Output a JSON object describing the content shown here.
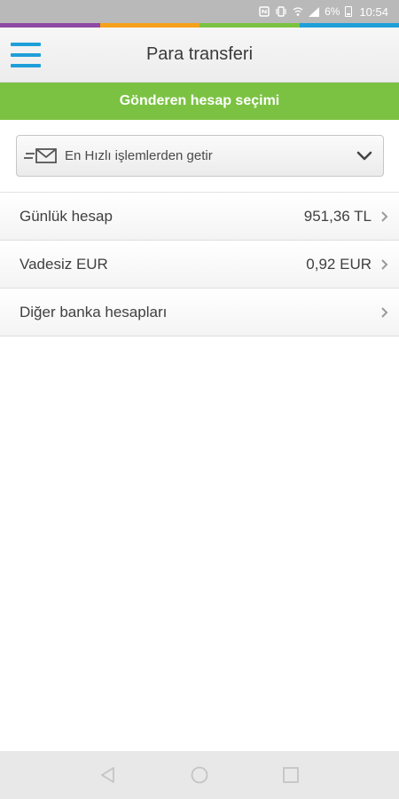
{
  "status_bar": {
    "battery_percent": "6%",
    "time": "10:54"
  },
  "brand_stripe": [
    "#8e4ba3",
    "#f6a11b",
    "#7bc242",
    "#1e9fd8"
  ],
  "header": {
    "title": "Para transferi",
    "menu_icon": "hamburger-menu-icon",
    "accent_color": "#1e9fd8"
  },
  "banner": {
    "label": "Gönderen hesap seçimi",
    "color": "#7bc242"
  },
  "quick_select": {
    "label": "En Hızlı işlemlerden getir",
    "icon": "mail-transfer-icon"
  },
  "accounts": [
    {
      "name": "Günlük hesap",
      "balance": "951,36 TL"
    },
    {
      "name": "Vadesiz EUR",
      "balance": "0,92 EUR"
    },
    {
      "name": "Diğer banka hesapları",
      "balance": ""
    }
  ],
  "nav_bar": {
    "buttons": [
      "back-icon",
      "home-icon",
      "recents-icon"
    ]
  }
}
